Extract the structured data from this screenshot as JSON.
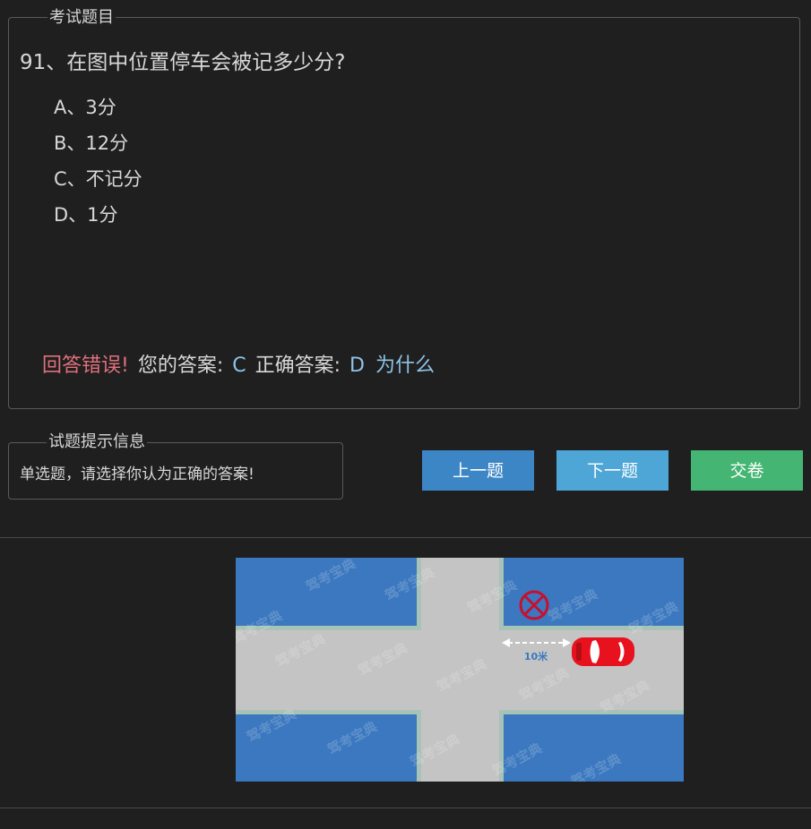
{
  "question_panel": {
    "legend": "考试题目",
    "question": "91、在图中位置停车会被记多少分?",
    "options": [
      {
        "label": "A、3分"
      },
      {
        "label": "B、12分"
      },
      {
        "label": "C、不记分"
      },
      {
        "label": "D、1分"
      }
    ],
    "result": {
      "status": "回答错误!",
      "your_answer_label": "您的答案:",
      "your_answer": "C",
      "correct_answer_label": "正确答案:",
      "correct_answer": "D",
      "why_link": "为什么"
    }
  },
  "hint_panel": {
    "legend": "试题提示信息",
    "text": "单选题，请选择你认为正确的答案!"
  },
  "buttons": {
    "prev": "上一题",
    "next": "下一题",
    "submit": "交卷"
  },
  "figure": {
    "distance_label": "10米",
    "watermark": "驾考宝典",
    "colors": {
      "block": "#3b78bf",
      "road": "#c4c4c4",
      "car": "#e8121e",
      "no_parking_sign": "#c8102e",
      "arrow": "#ffffff",
      "distance_text": "#3b78bf"
    }
  }
}
